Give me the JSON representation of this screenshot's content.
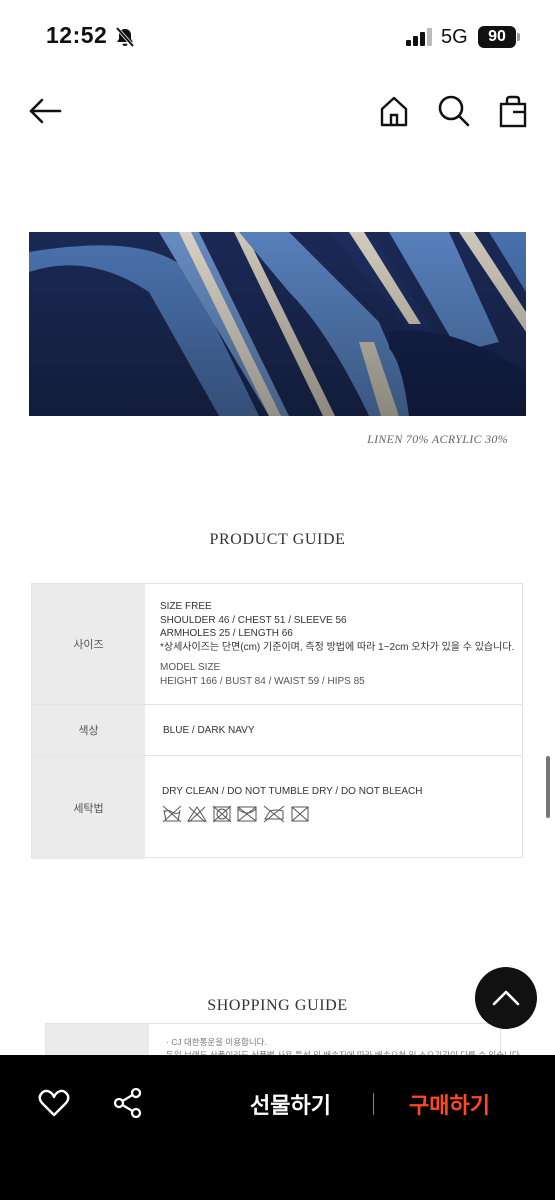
{
  "status_bar": {
    "time": "12:52",
    "network": "5G",
    "battery": "90"
  },
  "nav": {
    "icons": [
      "back-arrow-icon",
      "home-icon",
      "search-icon",
      "shopping-bag-icon"
    ]
  },
  "product": {
    "material": "LINEN 70% ACRYLIC 30%"
  },
  "product_guide": {
    "title": "PRODUCT GUIDE",
    "size_label": "사이즈",
    "size_lines": [
      "SIZE  FREE",
      "SHOULDER  46  /   CHEST  51  /   SLEEVE  56",
      "ARMHOLES  25  /  LENGTH  66",
      "*상세사이즈는 단면(cm) 기준이며, 측정 방법에 따라 1~2cm 오차가 있을 수 있습니다."
    ],
    "model_size_label": "MODEL SIZE",
    "model_size": "HEIGHT 166 / BUST 84 / WAIST 59 / HIPS 85",
    "color_label": "색상",
    "color_value": "BLUE / DARK NAVY",
    "wash_label": "세탁법",
    "wash_value": "DRY CLEAN / DO NOT TUMBLE DRY / DO NOT BLEACH",
    "care_icons": [
      "no-wash-icon",
      "no-bleach-icon",
      "no-tumble-dry-icon",
      "no-dry-icon",
      "no-iron-icon",
      "no-wring-icon"
    ]
  },
  "shopping_guide": {
    "title": "SHOPPING GUIDE",
    "line1": "· CJ 대한통운을 이용합니다.",
    "line2": "동일 브랜드 상품이라도 상품별 사용 특성 및 배송지에 따라 배송요청 및 소요기간이 다를 수 있습니다."
  },
  "bottom_bar": {
    "gift_label": "선물하기",
    "buy_label": "구매하기"
  },
  "colors": {
    "accent": "#ff4a1c",
    "bar": "#000000",
    "table_label_bg": "#ebebeb"
  }
}
